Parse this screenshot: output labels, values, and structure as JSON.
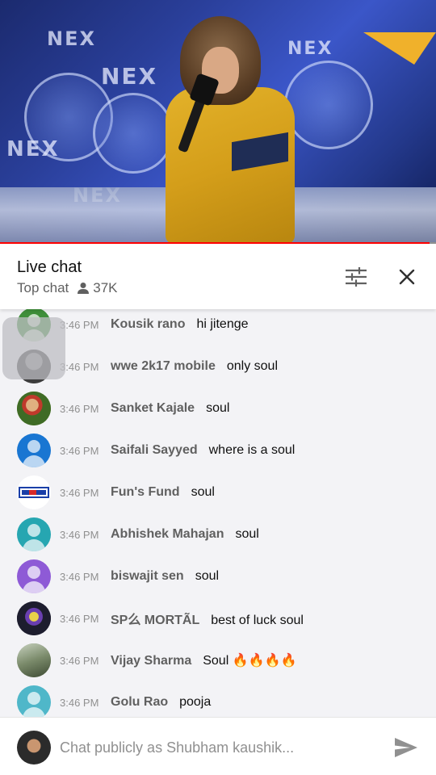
{
  "video": {
    "logo_text": "NEX",
    "progress": 0.985
  },
  "header": {
    "title": "Live chat",
    "mode": "Top chat",
    "viewers": "37K"
  },
  "messages": [
    {
      "time": "3:46 PM",
      "author": "Kousik rano",
      "text": "hi jitenge",
      "avatar_color": "#3f8f3a"
    },
    {
      "time": "3:46 PM",
      "author": "wwe 2k17 mobile",
      "text": "only soul",
      "avatar_color": "#555555"
    },
    {
      "time": "3:46 PM",
      "author": "Sanket Kajale",
      "text": "soul",
      "avatar_color": "#6b8f2a"
    },
    {
      "time": "3:46 PM",
      "author": "Saifali Sayyed",
      "text": "where is a soul",
      "avatar_color": "#1976d2"
    },
    {
      "time": "3:46 PM",
      "author": "Fun's Fund",
      "text": "soul",
      "avatar_color": "#ffffff"
    },
    {
      "time": "3:46 PM",
      "author": "Abhishek Mahajan",
      "text": "soul",
      "avatar_color": "#26a6b1"
    },
    {
      "time": "3:46 PM",
      "author": "biswajit sen",
      "text": "soul",
      "avatar_color": "#8e5ad6"
    },
    {
      "time": "3:46 PM",
      "author": "SP么 MORTÃL",
      "text": "best of luck soul",
      "avatar_color": "#1d1d2e"
    },
    {
      "time": "3:46 PM",
      "author": "Vijay Sharma",
      "text": "Soul 🔥🔥🔥🔥",
      "avatar_color": "#7a8a6a"
    },
    {
      "time": "3:46 PM",
      "author": "Golu Rao",
      "text": "pooja",
      "avatar_color": "#4fb7c9"
    }
  ],
  "input": {
    "placeholder": "Chat publicly as Shubham kaushik..."
  },
  "icons": {
    "filter": "tune-icon",
    "close": "close-icon",
    "viewers": "person-icon",
    "send": "send-icon"
  },
  "colors": {
    "progress": "#ff0000",
    "author": "#606060",
    "chat_bg": "#f3f3f6"
  }
}
